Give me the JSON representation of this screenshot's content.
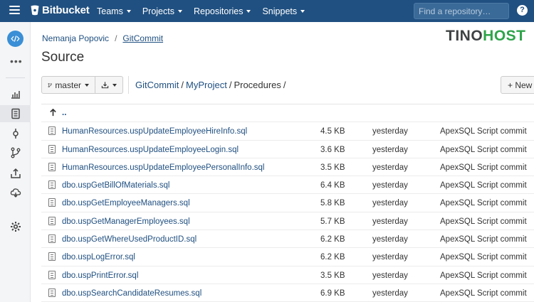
{
  "nav": {
    "logo_text": "Bitbucket",
    "menu": [
      "Teams",
      "Projects",
      "Repositories",
      "Snippets"
    ],
    "search_placeholder": "Find a repository…",
    "help_label": "?"
  },
  "sidebar": {
    "items": [
      "source-code-icon",
      "more-icon",
      "overview-icon",
      "source-icon",
      "commits-icon",
      "branches-icon",
      "deploy-icon",
      "pipelines-icon",
      "settings-icon"
    ],
    "active": "source-icon"
  },
  "breadcrumb": {
    "owner": "Nemanja Popovic",
    "separator": "/",
    "repo": "GitCommit"
  },
  "watermark": {
    "part1": "TINO",
    "part2": "HOST"
  },
  "page": {
    "title": "Source"
  },
  "toolbar": {
    "branch": "master",
    "new_label": "+ New"
  },
  "path": {
    "segments": [
      "GitCommit",
      "MyProject",
      "Procedures"
    ]
  },
  "files": {
    "up_label": "..",
    "rows": [
      {
        "name": "HumanResources.uspUpdateEmployeeHireInfo.sql",
        "size": "4.5 KB",
        "date": "yesterday",
        "message": "ApexSQL Script commit"
      },
      {
        "name": "HumanResources.uspUpdateEmployeeLogin.sql",
        "size": "3.6 KB",
        "date": "yesterday",
        "message": "ApexSQL Script commit"
      },
      {
        "name": "HumanResources.uspUpdateEmployeePersonalInfo.sql",
        "size": "3.5 KB",
        "date": "yesterday",
        "message": "ApexSQL Script commit"
      },
      {
        "name": "dbo.uspGetBillOfMaterials.sql",
        "size": "6.4 KB",
        "date": "yesterday",
        "message": "ApexSQL Script commit"
      },
      {
        "name": "dbo.uspGetEmployeeManagers.sql",
        "size": "5.8 KB",
        "date": "yesterday",
        "message": "ApexSQL Script commit"
      },
      {
        "name": "dbo.uspGetManagerEmployees.sql",
        "size": "5.7 KB",
        "date": "yesterday",
        "message": "ApexSQL Script commit"
      },
      {
        "name": "dbo.uspGetWhereUsedProductID.sql",
        "size": "6.2 KB",
        "date": "yesterday",
        "message": "ApexSQL Script commit"
      },
      {
        "name": "dbo.uspLogError.sql",
        "size": "6.2 KB",
        "date": "yesterday",
        "message": "ApexSQL Script commit"
      },
      {
        "name": "dbo.uspPrintError.sql",
        "size": "3.5 KB",
        "date": "yesterday",
        "message": "ApexSQL Script commit"
      },
      {
        "name": "dbo.uspSearchCandidateResumes.sql",
        "size": "6.9 KB",
        "date": "yesterday",
        "message": "ApexSQL Script commit"
      }
    ]
  },
  "colors": {
    "nav_bg": "#205081",
    "link": "#205081",
    "brand_green": "#2ea44a"
  }
}
